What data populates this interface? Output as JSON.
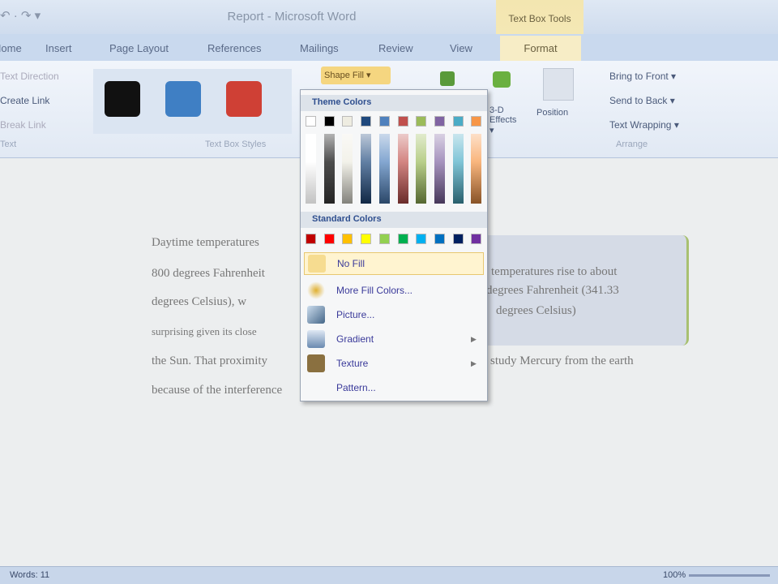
{
  "window": {
    "title": "Report - Microsoft Word",
    "qat": "↶ · ↷ ▾",
    "context_group": "Text Box Tools"
  },
  "tabs": [
    "Home",
    "Insert",
    "Page Layout",
    "References",
    "Mailings",
    "Review",
    "View"
  ],
  "active_tab": "Format",
  "ribbon": {
    "text_group": {
      "items": [
        "Text Direction",
        "Create Link",
        "Break Link"
      ],
      "label": "Text"
    },
    "styles_group": {
      "label": "Text Box Styles",
      "swatches": [
        "#111111",
        "#3f7fc4",
        "#cf4035"
      ]
    },
    "shape_fill": "Shape Fill ▾",
    "effects": "3-D Effects ▾",
    "position": "Position",
    "arrange": {
      "items": [
        "Bring to Front ▾",
        "Send to Back ▾",
        "Text Wrapping ▾"
      ],
      "label": "Arrange"
    }
  },
  "menu": {
    "theme_header": "Theme Colors",
    "theme_colors": [
      "#ffffff",
      "#000000",
      "#eeece1",
      "#1f497d",
      "#4f81bd",
      "#c0504d",
      "#9bbb59",
      "#8064a2",
      "#4bacc6",
      "#f79646"
    ],
    "standard_header": "Standard Colors",
    "standard_colors": [
      "#c00000",
      "#ff0000",
      "#ffc000",
      "#ffff00",
      "#92d050",
      "#00b050",
      "#00b0f0",
      "#0070c0",
      "#002060",
      "#7030a0"
    ],
    "items": [
      "No Fill",
      "More Fill Colors...",
      "Picture...",
      "Gradient",
      "Texture",
      "Pattern..."
    ]
  },
  "document": {
    "lines": [
      "Daytime temperatures",
      "800 degrees Fahrenheit",
      "degrees Celsius), w",
      "surprising given its close",
      "the Sun. That proximity",
      "because of the interference"
    ],
    "line_ends": [
      "",
      "",
      "",
      "",
      "study Mercury from the earth",
      ""
    ],
    "textbox": [
      "temperatures rise to about",
      "degrees Fahrenheit (341.33",
      "degrees Celsius)"
    ]
  },
  "status": {
    "words": "Words: 11",
    "zoom": "100%"
  }
}
